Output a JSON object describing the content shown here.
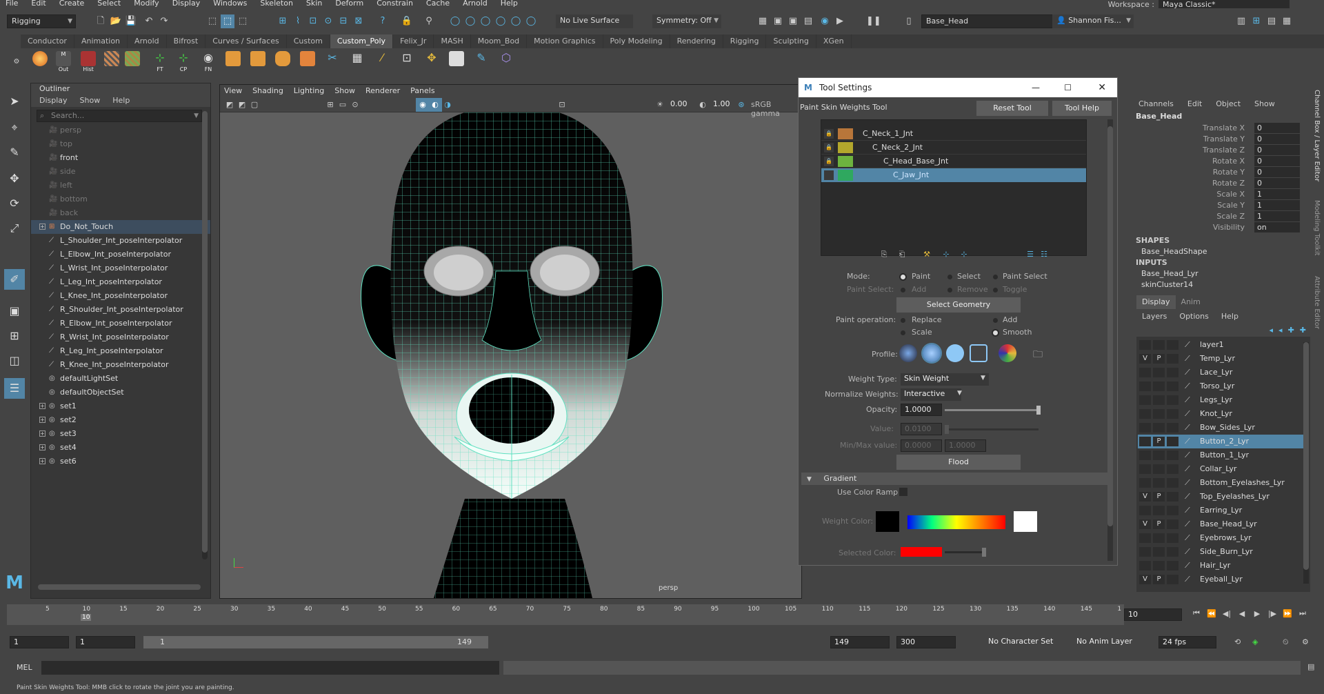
{
  "menubar": {
    "items": [
      "File",
      "Edit",
      "Create",
      "Select",
      "Modify",
      "Display",
      "Windows",
      "Skeleton",
      "Skin",
      "Deform",
      "Constrain",
      "Cache",
      "Arnold",
      "Help"
    ],
    "workspace_label": "Workspace :",
    "workspace_value": "Maya Classic*"
  },
  "statusline": {
    "menuset": "Rigging",
    "live_surface": "No Live Surface",
    "symmetry": "Symmetry: Off",
    "object_name": "Base_Head",
    "user": "Shannon Fis..."
  },
  "shelf": {
    "tabs": [
      "Conductor",
      "Animation",
      "Arnold",
      "Bifrost",
      "Curves / Surfaces",
      "Custom",
      "Custom_Poly",
      "Felix_Jr",
      "MASH",
      "Moom_Bod",
      "Motion Graphics",
      "Poly Modeling",
      "Rendering",
      "Rigging",
      "Sculpting",
      "XGen"
    ],
    "active_tab": "Custom_Poly",
    "buttons": [
      "Out",
      "Hist",
      "FT",
      "CP",
      "FN"
    ]
  },
  "outliner": {
    "title": "Outliner",
    "menu": [
      "Display",
      "Show",
      "Help"
    ],
    "search_placeholder": "Search...",
    "items": [
      {
        "label": "persp",
        "type": "camera",
        "dim": true
      },
      {
        "label": "top",
        "type": "camera",
        "dim": true
      },
      {
        "label": "front",
        "type": "camera",
        "dim": false
      },
      {
        "label": "side",
        "type": "camera",
        "dim": true
      },
      {
        "label": "left",
        "type": "camera",
        "dim": true
      },
      {
        "label": "bottom",
        "type": "camera",
        "dim": true
      },
      {
        "label": "back",
        "type": "camera",
        "dim": true
      },
      {
        "label": "Do_Not_Touch",
        "type": "group",
        "expand": true,
        "selected": true
      },
      {
        "label": "L_Shoulder_Int_poseInterpolator",
        "type": "pose"
      },
      {
        "label": "L_Elbow_Int_poseInterpolator",
        "type": "pose"
      },
      {
        "label": "L_Wrist_Int_poseInterpolator",
        "type": "pose"
      },
      {
        "label": "L_Leg_Int_poseInterpolator",
        "type": "pose"
      },
      {
        "label": "L_Knee_Int_poseInterpolator",
        "type": "pose"
      },
      {
        "label": "R_Shoulder_Int_poseInterpolator",
        "type": "pose"
      },
      {
        "label": "R_Elbow_Int_poseInterpolator",
        "type": "pose"
      },
      {
        "label": "R_Wrist_Int_poseInterpolator",
        "type": "pose"
      },
      {
        "label": "R_Leg_Int_poseInterpolator",
        "type": "pose"
      },
      {
        "label": "R_Knee_Int_poseInterpolator",
        "type": "pose"
      },
      {
        "label": "defaultLightSet",
        "type": "set"
      },
      {
        "label": "defaultObjectSet",
        "type": "set"
      },
      {
        "label": "set1",
        "type": "set",
        "expand": true
      },
      {
        "label": "set2",
        "type": "set",
        "expand": true
      },
      {
        "label": "set3",
        "type": "set",
        "expand": true
      },
      {
        "label": "set4",
        "type": "set",
        "expand": true
      },
      {
        "label": "set6",
        "type": "set",
        "expand": true
      }
    ]
  },
  "viewport": {
    "menu": [
      "View",
      "Shading",
      "Lighting",
      "Show",
      "Renderer",
      "Panels"
    ],
    "exposure": "0.00",
    "gamma": "1.00",
    "colorspace": "sRGB gamma",
    "camera_label": "persp"
  },
  "tool_settings": {
    "window_title": "Tool Settings",
    "tool_name": "Paint Skin Weights Tool",
    "reset_label": "Reset Tool",
    "help_label": "Tool Help",
    "influences": [
      {
        "label": "C_Neck_1_Jnt",
        "color": "#b8763a"
      },
      {
        "label": "C_Neck_2_Jnt",
        "color": "#b3a72c"
      },
      {
        "label": "C_Head_Base_Jnt",
        "color": "#6db33f"
      },
      {
        "label": "C_Jaw_Jnt",
        "color": "#2fa85f",
        "selected": true
      }
    ],
    "mode_label": "Mode:",
    "mode_options": [
      "Paint",
      "Select",
      "Paint Select"
    ],
    "paint_select_label": "Paint Select:",
    "paint_select_options": [
      "Add",
      "Remove",
      "Toggle"
    ],
    "select_geometry": "Select Geometry",
    "paint_operation_label": "Paint operation:",
    "paint_operations": [
      "Replace",
      "Add",
      "Scale",
      "Smooth"
    ],
    "profile_label": "Profile:",
    "weight_type_label": "Weight Type:",
    "weight_type": "Skin Weight",
    "normalize_label": "Normalize Weights:",
    "normalize": "Interactive",
    "opacity_label": "Opacity:",
    "opacity": "1.0000",
    "opacity_level": 1.0,
    "value_label": "Value:",
    "value": "0.0100",
    "minmax_label": "Min/Max value:",
    "min": "0.0000",
    "max": "1.0000",
    "flood": "Flood",
    "gradient_label": "Gradient",
    "use_color_ramp": "Use Color Ramp",
    "weight_color_label": "Weight Color:",
    "selected_color_label": "Selected Color:",
    "selected_color": "#ff0000"
  },
  "channel_box": {
    "menu": [
      "Channels",
      "Edit",
      "Object",
      "Show"
    ],
    "object": "Base_Head",
    "channels": [
      {
        "name": "Translate X",
        "value": "0"
      },
      {
        "name": "Translate Y",
        "value": "0"
      },
      {
        "name": "Translate Z",
        "value": "0"
      },
      {
        "name": "Rotate X",
        "value": "0"
      },
      {
        "name": "Rotate Y",
        "value": "0"
      },
      {
        "name": "Rotate Z",
        "value": "0"
      },
      {
        "name": "Scale X",
        "value": "1"
      },
      {
        "name": "Scale Y",
        "value": "1"
      },
      {
        "name": "Scale Z",
        "value": "1"
      },
      {
        "name": "Visibility",
        "value": "on"
      }
    ],
    "shapes_label": "SHAPES",
    "shape": "Base_HeadShape",
    "inputs_label": "INPUTS",
    "inputs": [
      "Base_Head_Lyr",
      "skinCluster14"
    ],
    "side_tabs": [
      "Channel Box / Layer Editor",
      "Modeling Toolkit",
      "Attribute Editor"
    ]
  },
  "layer_editor": {
    "tabs": [
      "Display",
      "Anim"
    ],
    "menu": [
      "Layers",
      "Options",
      "Help"
    ],
    "layers": [
      {
        "name": "layer1",
        "v": "",
        "p": ""
      },
      {
        "name": "Temp_Lyr",
        "v": "V",
        "p": "P"
      },
      {
        "name": "Lace_Lyr",
        "v": "",
        "p": ""
      },
      {
        "name": "Torso_Lyr",
        "v": "",
        "p": ""
      },
      {
        "name": "Legs_Lyr",
        "v": "",
        "p": ""
      },
      {
        "name": "Knot_Lyr",
        "v": "",
        "p": ""
      },
      {
        "name": "Bow_Sides_Lyr",
        "v": "",
        "p": ""
      },
      {
        "name": "Button_2_Lyr",
        "v": "",
        "p": "P",
        "selected": true
      },
      {
        "name": "Button_1_Lyr",
        "v": "",
        "p": ""
      },
      {
        "name": "Collar_Lyr",
        "v": "",
        "p": ""
      },
      {
        "name": "Bottom_Eyelashes_Lyr",
        "v": "",
        "p": ""
      },
      {
        "name": "Top_Eyelashes_Lyr",
        "v": "V",
        "p": "P"
      },
      {
        "name": "Earring_Lyr",
        "v": "",
        "p": ""
      },
      {
        "name": "Base_Head_Lyr",
        "v": "V",
        "p": "P"
      },
      {
        "name": "Eyebrows_Lyr",
        "v": "",
        "p": ""
      },
      {
        "name": "Side_Burn_Lyr",
        "v": "",
        "p": ""
      },
      {
        "name": "Hair_Lyr",
        "v": "",
        "p": ""
      },
      {
        "name": "Eyeball_Lyr",
        "v": "V",
        "p": "P"
      }
    ]
  },
  "timeline": {
    "ticks": [
      "5",
      "10",
      "15",
      "20",
      "25",
      "30",
      "35",
      "40",
      "45",
      "50",
      "55",
      "60",
      "65",
      "70",
      "75",
      "80",
      "85",
      "90",
      "95",
      "100",
      "105",
      "110",
      "115",
      "120",
      "125",
      "130",
      "135",
      "140",
      "145",
      "1"
    ],
    "current_frame_marker": "10",
    "current_frame": "10"
  },
  "range": {
    "start": "1",
    "playback_start": "1",
    "slider_start": "1",
    "slider_end": "149",
    "playback_end": "149",
    "end": "300",
    "character_set": "No Character Set",
    "anim_layer": "No Anim Layer",
    "fps": "24 fps"
  },
  "command_line": {
    "lang": "MEL"
  },
  "help_line": "Paint Skin Weights Tool: MMB click to rotate the joint you are painting."
}
